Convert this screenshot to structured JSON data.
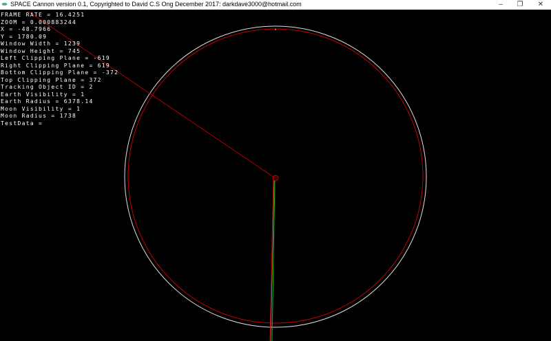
{
  "window": {
    "title": "SPACE Cannon version 0.1, Copyrighted to David C.S Ong  December 2017: darkdave3000@hotmail.com",
    "minimize": "–",
    "maximize": "❐",
    "close": "✕"
  },
  "hud": [
    "FRAME RATE = 16.4251",
    "ZOOM = 0.000883244",
    "X = -48.7966",
    "Y = 1780.09",
    "Window Width = 1239",
    "Window Height = 745",
    "Left Clipping Plane = -619",
    "Right Clipping Plane = 619",
    "Bottom Clipping Plane = -372",
    "Top Clipping Plane = 372",
    "Tracking Object ID = 2",
    "Earth Visibility = 1",
    "Earth Radius = 6378.14",
    "Moon Visibility = 1",
    "Moon Radius = 1738",
    "TestData ="
  ],
  "colors": {
    "orbit_white": "#e0e0e0",
    "orbit_red": "#c00000",
    "trajectory_green": "#00c000",
    "background": "#000000"
  }
}
